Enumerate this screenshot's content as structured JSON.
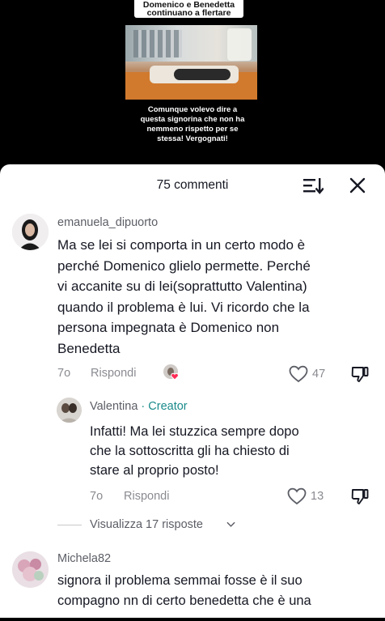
{
  "video": {
    "title_lines": [
      "Domenico e Benedetta",
      "continuano a flertare"
    ],
    "caption_lines": [
      "Comunque volevo dire a",
      "questa signorina che non ha",
      "nemmeno rispetto per se",
      "stessa! Vergognati!"
    ]
  },
  "header": {
    "title": "75 commenti",
    "sort_icon": "sort-icon",
    "close_icon": "close-icon"
  },
  "comments": [
    {
      "username": "emanuela_dipuorto",
      "text_lines": [
        "Ma se lei si comporta in un certo modo è",
        "perché Domenico glielo permette. Perché",
        "vi accanite su di lei(soprattutto Valentina)",
        "quando il problema è lui. Vi ricordo che la",
        "persona impegnata è Domenico non",
        "Benedetta"
      ],
      "time": "7o",
      "reply_label": "Rispondi",
      "likes": "47",
      "creator_liked": true
    },
    {
      "username": "Valentina",
      "badge": "· Creator",
      "text_lines": [
        "Infatti! Ma lei stuzzica sempre dopo",
        "che la sottoscritta gli ha chiesto di",
        "stare al proprio posto!"
      ],
      "time": "7o",
      "reply_label": "Rispondi",
      "likes": "13"
    },
    {
      "username": "Michela82",
      "text_lines": [
        "signora il problema semmai fosse è il suo",
        "compagno nn di certo benedetta che è una"
      ]
    }
  ],
  "view_replies": "Visualizza 17 risposte",
  "colors": {
    "accent_creator": "#1a8a8a",
    "heart_red": "#fe2c55",
    "muted": "#8a8b91"
  }
}
